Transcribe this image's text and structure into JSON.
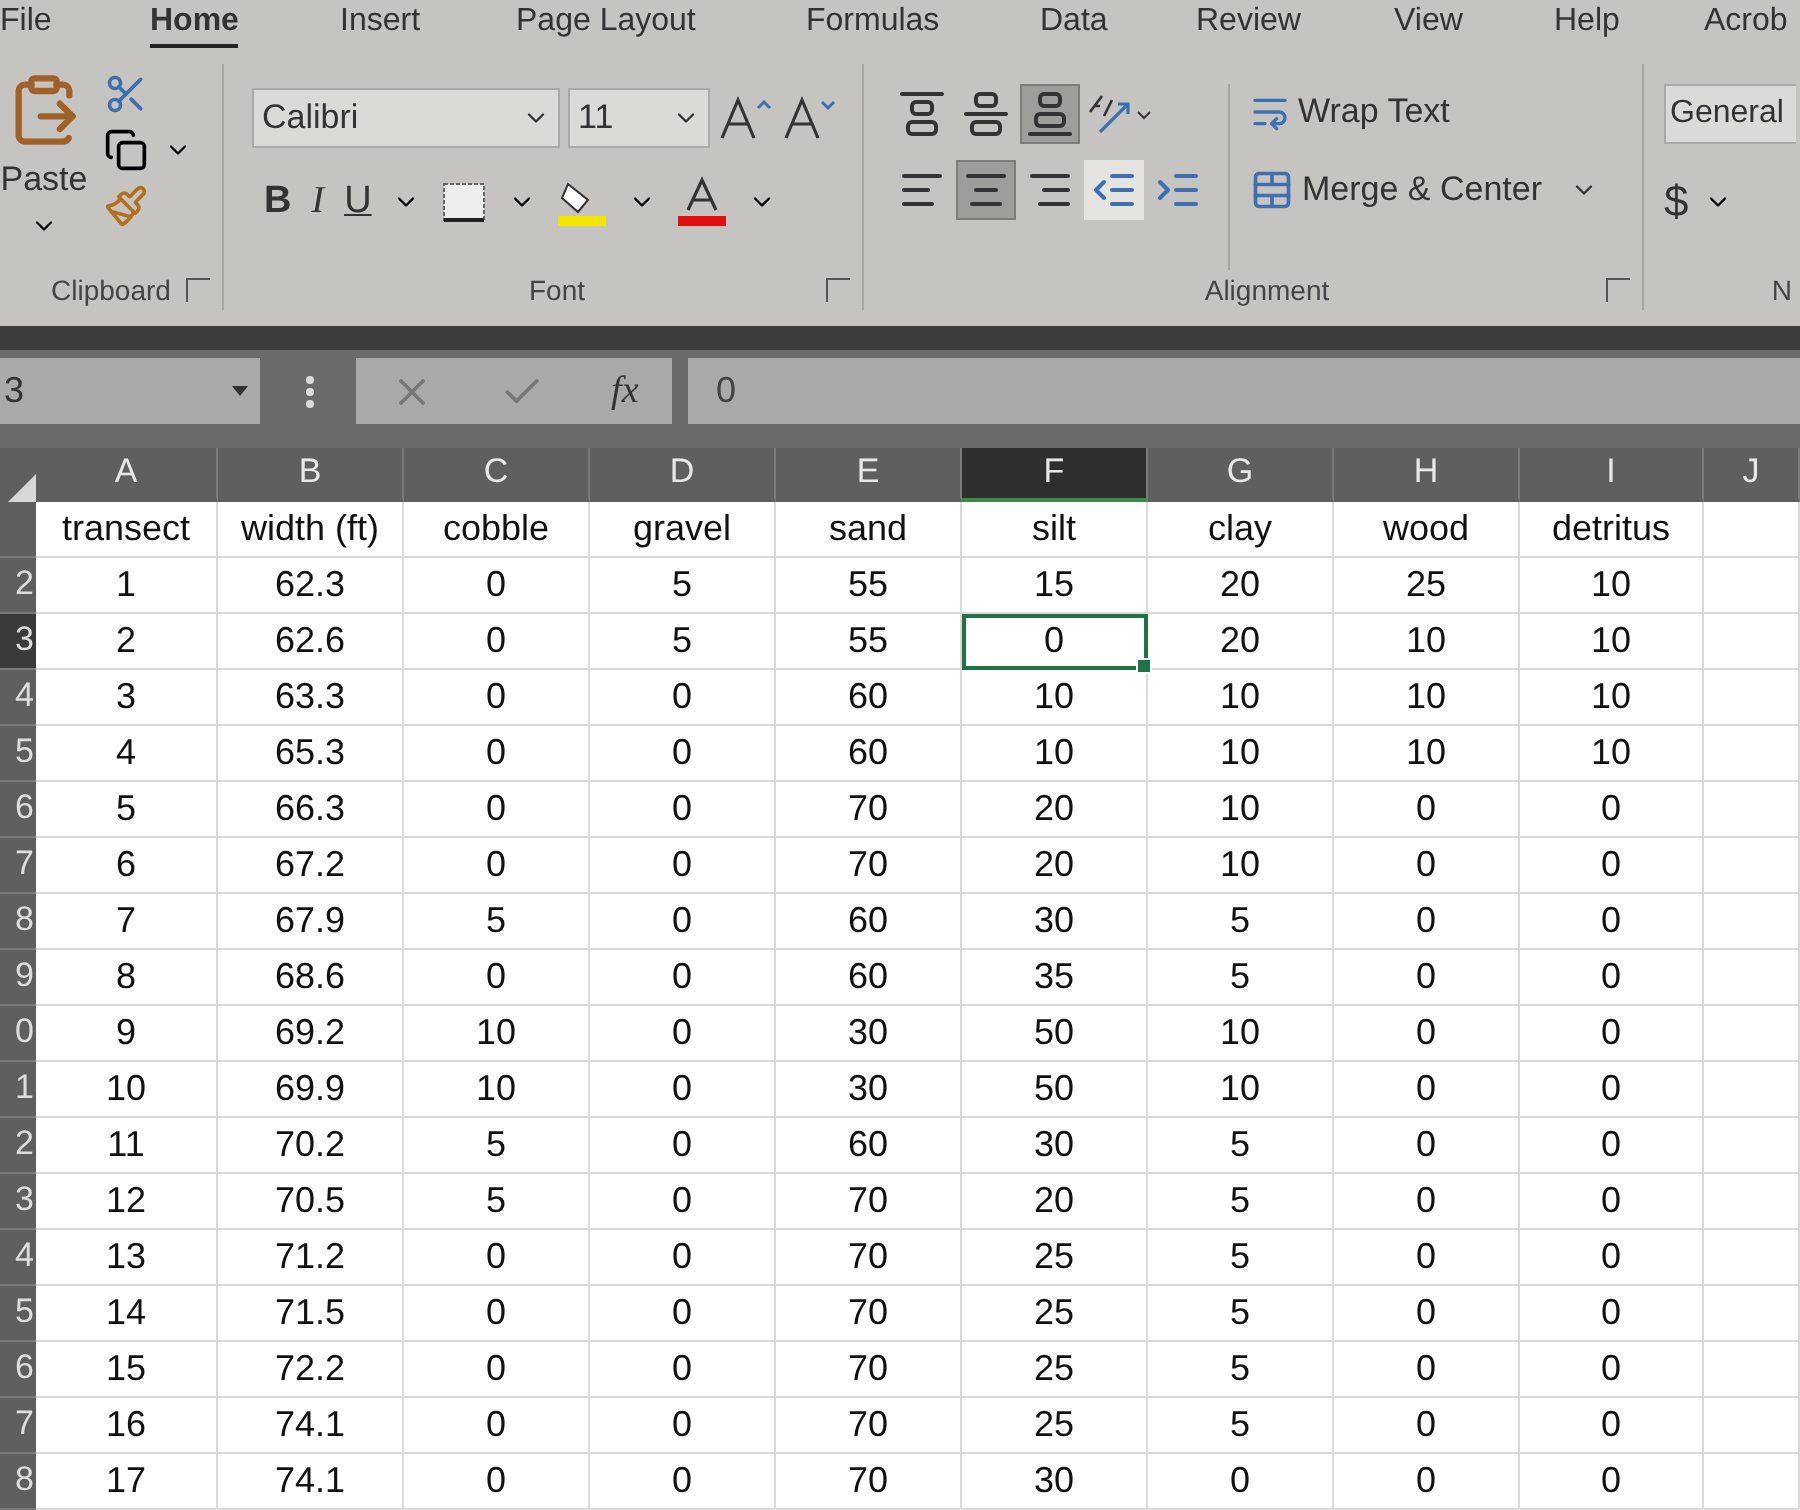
{
  "tabs": [
    {
      "label": "File",
      "selected": false
    },
    {
      "label": "Home",
      "selected": true
    },
    {
      "label": "Insert",
      "selected": false
    },
    {
      "label": "Page Layout",
      "selected": false
    },
    {
      "label": "Formulas",
      "selected": false
    },
    {
      "label": "Data",
      "selected": false
    },
    {
      "label": "Review",
      "selected": false
    },
    {
      "label": "View",
      "selected": false
    },
    {
      "label": "Help",
      "selected": false
    },
    {
      "label": "Acrob",
      "selected": false
    }
  ],
  "ribbon": {
    "clipboard": {
      "label": "Clipboard",
      "paste": "Paste"
    },
    "font": {
      "label": "Font",
      "font_name": "Calibri",
      "font_size": "11",
      "bold": "B",
      "italic": "I",
      "underline": "U"
    },
    "alignment": {
      "label": "Alignment",
      "vertical": [
        {
          "kind": "top",
          "selected": false
        },
        {
          "kind": "middle",
          "selected": false
        },
        {
          "kind": "bottom",
          "selected": true
        }
      ],
      "horizontal": [
        {
          "kind": "left",
          "selected": false
        },
        {
          "kind": "center",
          "selected": true
        },
        {
          "kind": "right",
          "selected": false
        }
      ],
      "wrap_text": "Wrap Text",
      "merge": "Merge & Center"
    },
    "number": {
      "format": "General",
      "currency": "$",
      "label": "N"
    }
  },
  "formula_bar": {
    "name_box": "3",
    "fx": "fx",
    "value": "0"
  },
  "columns": [
    {
      "letter": "A",
      "selected": false
    },
    {
      "letter": "B",
      "selected": false
    },
    {
      "letter": "C",
      "selected": false
    },
    {
      "letter": "D",
      "selected": false
    },
    {
      "letter": "E",
      "selected": false
    },
    {
      "letter": "F",
      "selected": true
    },
    {
      "letter": "G",
      "selected": false
    },
    {
      "letter": "H",
      "selected": false
    },
    {
      "letter": "I",
      "selected": false
    },
    {
      "letter": "J",
      "selected": false
    }
  ],
  "rows": [
    {
      "header": "",
      "selected": false,
      "cells": [
        "transect",
        "width (ft)",
        "cobble",
        "gravel",
        "sand",
        "silt",
        "clay",
        "wood",
        "detritus"
      ]
    },
    {
      "header": "2",
      "selected": false,
      "cells": [
        "1",
        "62.3",
        "0",
        "5",
        "55",
        "15",
        "20",
        "25",
        "10"
      ]
    },
    {
      "header": "3",
      "selected": true,
      "cells": [
        "2",
        "62.6",
        "0",
        "5",
        "55",
        "0",
        "20",
        "10",
        "10"
      ]
    },
    {
      "header": "4",
      "selected": false,
      "cells": [
        "3",
        "63.3",
        "0",
        "0",
        "60",
        "10",
        "10",
        "10",
        "10"
      ]
    },
    {
      "header": "5",
      "selected": false,
      "cells": [
        "4",
        "65.3",
        "0",
        "0",
        "60",
        "10",
        "10",
        "10",
        "10"
      ]
    },
    {
      "header": "6",
      "selected": false,
      "cells": [
        "5",
        "66.3",
        "0",
        "0",
        "70",
        "20",
        "10",
        "0",
        "0"
      ]
    },
    {
      "header": "7",
      "selected": false,
      "cells": [
        "6",
        "67.2",
        "0",
        "0",
        "70",
        "20",
        "10",
        "0",
        "0"
      ]
    },
    {
      "header": "8",
      "selected": false,
      "cells": [
        "7",
        "67.9",
        "5",
        "0",
        "60",
        "30",
        "5",
        "0",
        "0"
      ]
    },
    {
      "header": "9",
      "selected": false,
      "cells": [
        "8",
        "68.6",
        "0",
        "0",
        "60",
        "35",
        "5",
        "0",
        "0"
      ]
    },
    {
      "header": "0",
      "selected": false,
      "cells": [
        "9",
        "69.2",
        "10",
        "0",
        "30",
        "50",
        "10",
        "0",
        "0"
      ]
    },
    {
      "header": "1",
      "selected": false,
      "cells": [
        "10",
        "69.9",
        "10",
        "0",
        "30",
        "50",
        "10",
        "0",
        "0"
      ]
    },
    {
      "header": "2",
      "selected": false,
      "cells": [
        "11",
        "70.2",
        "5",
        "0",
        "60",
        "30",
        "5",
        "0",
        "0"
      ]
    },
    {
      "header": "3",
      "selected": false,
      "cells": [
        "12",
        "70.5",
        "5",
        "0",
        "70",
        "20",
        "5",
        "0",
        "0"
      ]
    },
    {
      "header": "4",
      "selected": false,
      "cells": [
        "13",
        "71.2",
        "0",
        "0",
        "70",
        "25",
        "5",
        "0",
        "0"
      ]
    },
    {
      "header": "5",
      "selected": false,
      "cells": [
        "14",
        "71.5",
        "0",
        "0",
        "70",
        "25",
        "5",
        "0",
        "0"
      ]
    },
    {
      "header": "6",
      "selected": false,
      "cells": [
        "15",
        "72.2",
        "0",
        "0",
        "70",
        "25",
        "5",
        "0",
        "0"
      ]
    },
    {
      "header": "7",
      "selected": false,
      "cells": [
        "16",
        "74.1",
        "0",
        "0",
        "70",
        "25",
        "5",
        "0",
        "0"
      ]
    },
    {
      "header": "8",
      "selected": false,
      "cells": [
        "17",
        "74.1",
        "0",
        "0",
        "70",
        "30",
        "0",
        "0",
        "0"
      ]
    }
  ]
}
